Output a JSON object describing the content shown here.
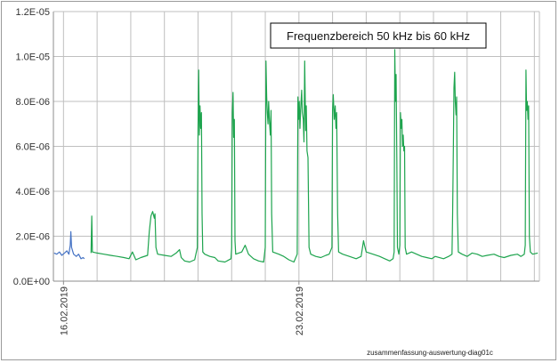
{
  "chart_data": {
    "type": "line",
    "title": "",
    "xlabel": "",
    "ylabel": "",
    "ylim": [
      0,
      1.2e-05
    ],
    "y_ticks": [
      "0.0E+00",
      "2.0E-06",
      "4.0E-06",
      "6.0E-06",
      "8.0E-06",
      "1.0E-05",
      "1.2E-05"
    ],
    "y_tick_values": [
      0,
      2e-06,
      4e-06,
      6e-06,
      8e-06,
      1e-05,
      1.2e-05
    ],
    "x_unit": "days",
    "xlim": [
      -0.3,
      14.15
    ],
    "x_tick_labels": [
      {
        "day": 0,
        "label": "16.02.2019"
      },
      {
        "day": 7,
        "label": "23.02.2019"
      }
    ],
    "grid": true,
    "vertical_grid_step_days": 1,
    "annotation": "Frequenzbereich 50 kHz bis 60 kHz",
    "footer": "zusammenfassung-auswertung-diag01c",
    "series": [
      {
        "color": "#4472C4",
        "points": [
          [
            -0.28,
            1.25e-06
          ],
          [
            -0.2,
            1.2e-06
          ],
          [
            -0.12,
            1.3e-06
          ],
          [
            -0.05,
            1.15e-06
          ],
          [
            0.03,
            1.25e-06
          ],
          [
            0.1,
            1.35e-06
          ],
          [
            0.16,
            1.2e-06
          ],
          [
            0.2,
            1.6e-06
          ],
          [
            0.22,
            2.2e-06
          ],
          [
            0.24,
            1.5e-06
          ],
          [
            0.3,
            1.2e-06
          ],
          [
            0.38,
            1.1e-06
          ],
          [
            0.45,
            1.2e-06
          ],
          [
            0.52,
            1e-06
          ],
          [
            0.58,
            1.05e-06
          ],
          [
            0.62,
            1e-06
          ]
        ]
      },
      {
        "color": "#1EA44E",
        "points": [
          [
            0.82,
            1.25e-06
          ],
          [
            0.84,
            2.9e-06
          ],
          [
            0.86,
            1.3e-06
          ],
          [
            1.0,
            1.25e-06
          ],
          [
            1.2,
            1.2e-06
          ],
          [
            1.4,
            1.15e-06
          ],
          [
            1.6,
            1.1e-06
          ],
          [
            1.8,
            1.05e-06
          ],
          [
            1.95,
            1e-06
          ],
          [
            2.05,
            1.3e-06
          ],
          [
            2.15,
            9.5e-07
          ],
          [
            2.3,
            1.05e-06
          ],
          [
            2.5,
            1.15e-06
          ],
          [
            2.55,
            2.2e-06
          ],
          [
            2.6,
            2.9e-06
          ],
          [
            2.65,
            3.1e-06
          ],
          [
            2.7,
            2.8e-06
          ],
          [
            2.72,
            3e-06
          ],
          [
            2.75,
            1.5e-06
          ],
          [
            2.8,
            1.2e-06
          ],
          [
            3.0,
            1.15e-06
          ],
          [
            3.2,
            1.1e-06
          ],
          [
            3.35,
            1.25e-06
          ],
          [
            3.45,
            1.4e-06
          ],
          [
            3.5,
            1.05e-06
          ],
          [
            3.6,
            9e-07
          ],
          [
            3.75,
            8.5e-07
          ],
          [
            3.9,
            9.5e-07
          ],
          [
            3.98,
            1.5e-06
          ],
          [
            4.0,
            6.8e-06
          ],
          [
            4.02,
            9.4e-06
          ],
          [
            4.04,
            6.5e-06
          ],
          [
            4.06,
            7.8e-06
          ],
          [
            4.08,
            6.8e-06
          ],
          [
            4.1,
            7.5e-06
          ],
          [
            4.12,
            3e-06
          ],
          [
            4.14,
            1.3e-06
          ],
          [
            4.2,
            1.2e-06
          ],
          [
            4.35,
            1.1e-06
          ],
          [
            4.5,
            1.05e-06
          ],
          [
            4.6,
            9e-07
          ],
          [
            4.8,
            8.5e-07
          ],
          [
            4.98,
            1e-06
          ],
          [
            5.0,
            1.5e-06
          ],
          [
            5.02,
            7.5e-06
          ],
          [
            5.04,
            8.4e-06
          ],
          [
            5.06,
            6.4e-06
          ],
          [
            5.08,
            7.2e-06
          ],
          [
            5.1,
            1.8e-06
          ],
          [
            5.12,
            1.2e-06
          ],
          [
            5.3,
            1.3e-06
          ],
          [
            5.4,
            1.6e-06
          ],
          [
            5.5,
            1.2e-06
          ],
          [
            5.65,
            1e-06
          ],
          [
            5.8,
            9e-07
          ],
          [
            5.95,
            8.5e-07
          ],
          [
            6.0,
            1.5e-06
          ],
          [
            6.02,
            9.8e-06
          ],
          [
            6.04,
            8.2e-06
          ],
          [
            6.06,
            7.5e-06
          ],
          [
            6.08,
            7e-06
          ],
          [
            6.1,
            8e-06
          ],
          [
            6.12,
            7.2e-06
          ],
          [
            6.15,
            6.5e-06
          ],
          [
            6.17,
            7.6e-06
          ],
          [
            6.19,
            3e-06
          ],
          [
            6.22,
            1.3e-06
          ],
          [
            6.4,
            1.2e-06
          ],
          [
            6.55,
            1.1e-06
          ],
          [
            6.7,
            9.5e-07
          ],
          [
            6.85,
            8.5e-07
          ],
          [
            6.95,
            1.2e-06
          ],
          [
            6.97,
            8.2e-06
          ],
          [
            6.99,
            7.2e-06
          ],
          [
            7.01,
            8e-06
          ],
          [
            7.03,
            6.8e-06
          ],
          [
            7.05,
            7.6e-06
          ],
          [
            7.08,
            8.5e-06
          ],
          [
            7.1,
            7.5e-06
          ],
          [
            7.13,
            7.2e-06
          ],
          [
            7.15,
            6.2e-06
          ],
          [
            7.17,
            9.8e-06
          ],
          [
            7.2,
            6.7e-06
          ],
          [
            7.22,
            7.8e-06
          ],
          [
            7.24,
            5.8e-06
          ],
          [
            7.27,
            5.5e-06
          ],
          [
            7.3,
            1.5e-06
          ],
          [
            7.35,
            1.2e-06
          ],
          [
            7.5,
            1.1e-06
          ],
          [
            7.65,
            1.05e-06
          ],
          [
            7.8,
            1.15e-06
          ],
          [
            7.9,
            1.2e-06
          ],
          [
            7.98,
            1.5e-06
          ],
          [
            8.0,
            7.6e-06
          ],
          [
            8.02,
            8.3e-06
          ],
          [
            8.05,
            7.2e-06
          ],
          [
            8.08,
            7.8e-06
          ],
          [
            8.1,
            6.8e-06
          ],
          [
            8.12,
            7.5e-06
          ],
          [
            8.15,
            3e-06
          ],
          [
            8.18,
            1.3e-06
          ],
          [
            8.3,
            1.2e-06
          ],
          [
            8.5,
            1.1e-06
          ],
          [
            8.7,
            1e-06
          ],
          [
            8.85,
            1.1e-06
          ],
          [
            8.92,
            1.8e-06
          ],
          [
            8.95,
            1.6e-06
          ],
          [
            9.0,
            1.3e-06
          ],
          [
            9.2,
            1.2e-06
          ],
          [
            9.4,
            1.1e-06
          ],
          [
            9.55,
            1e-06
          ],
          [
            9.7,
            9e-07
          ],
          [
            9.8,
            1e-06
          ],
          [
            9.83,
            1.3e-06
          ],
          [
            9.85,
            1.03e-05
          ],
          [
            9.87,
            8e-06
          ],
          [
            9.89,
            9.2e-06
          ],
          [
            9.91,
            5.5e-06
          ],
          [
            9.93,
            1.5e-06
          ],
          [
            9.97,
            1.2e-06
          ],
          [
            10.0,
            1.6e-06
          ],
          [
            10.02,
            7.5e-06
          ],
          [
            10.04,
            6.8e-06
          ],
          [
            10.06,
            7.2e-06
          ],
          [
            10.08,
            6e-06
          ],
          [
            10.1,
            6.5e-06
          ],
          [
            10.12,
            5.8e-06
          ],
          [
            10.14,
            6e-06
          ],
          [
            10.16,
            1.5e-06
          ],
          [
            10.2,
            1.2e-06
          ],
          [
            10.35,
            1.3e-06
          ],
          [
            10.5,
            1.2e-06
          ],
          [
            10.65,
            1.1e-06
          ],
          [
            10.8,
            1.05e-06
          ],
          [
            10.95,
            1e-06
          ],
          [
            11.05,
            1.1e-06
          ],
          [
            11.3,
            1e-06
          ],
          [
            11.45,
            1.1e-06
          ],
          [
            11.55,
            1.2e-06
          ],
          [
            11.57,
            3e-06
          ],
          [
            11.59,
            5.8e-06
          ],
          [
            11.61,
            8.6e-06
          ],
          [
            11.63,
            9.3e-06
          ],
          [
            11.65,
            8e-06
          ],
          [
            11.67,
            7.4e-06
          ],
          [
            11.69,
            8.2e-06
          ],
          [
            11.71,
            3e-06
          ],
          [
            11.74,
            1.3e-06
          ],
          [
            11.85,
            1.2e-06
          ],
          [
            12.0,
            1.1e-06
          ],
          [
            12.15,
            1.25e-06
          ],
          [
            12.3,
            1.2e-06
          ],
          [
            12.45,
            1.1e-06
          ],
          [
            12.6,
            1.15e-06
          ],
          [
            12.8,
            1.2e-06
          ],
          [
            12.95,
            1.1e-06
          ],
          [
            13.1,
            1.05e-06
          ],
          [
            13.3,
            1.15e-06
          ],
          [
            13.5,
            1.2e-06
          ],
          [
            13.6,
            1.1e-06
          ],
          [
            13.7,
            1.2e-06
          ],
          [
            13.73,
            1.6e-06
          ],
          [
            13.75,
            9.4e-06
          ],
          [
            13.77,
            7.6e-06
          ],
          [
            13.79,
            8e-06
          ],
          [
            13.81,
            7.2e-06
          ],
          [
            13.83,
            7.8e-06
          ],
          [
            13.85,
            2e-06
          ],
          [
            13.88,
            1.3e-06
          ],
          [
            13.95,
            1.2e-06
          ],
          [
            14.1,
            1.25e-06
          ]
        ]
      }
    ]
  }
}
